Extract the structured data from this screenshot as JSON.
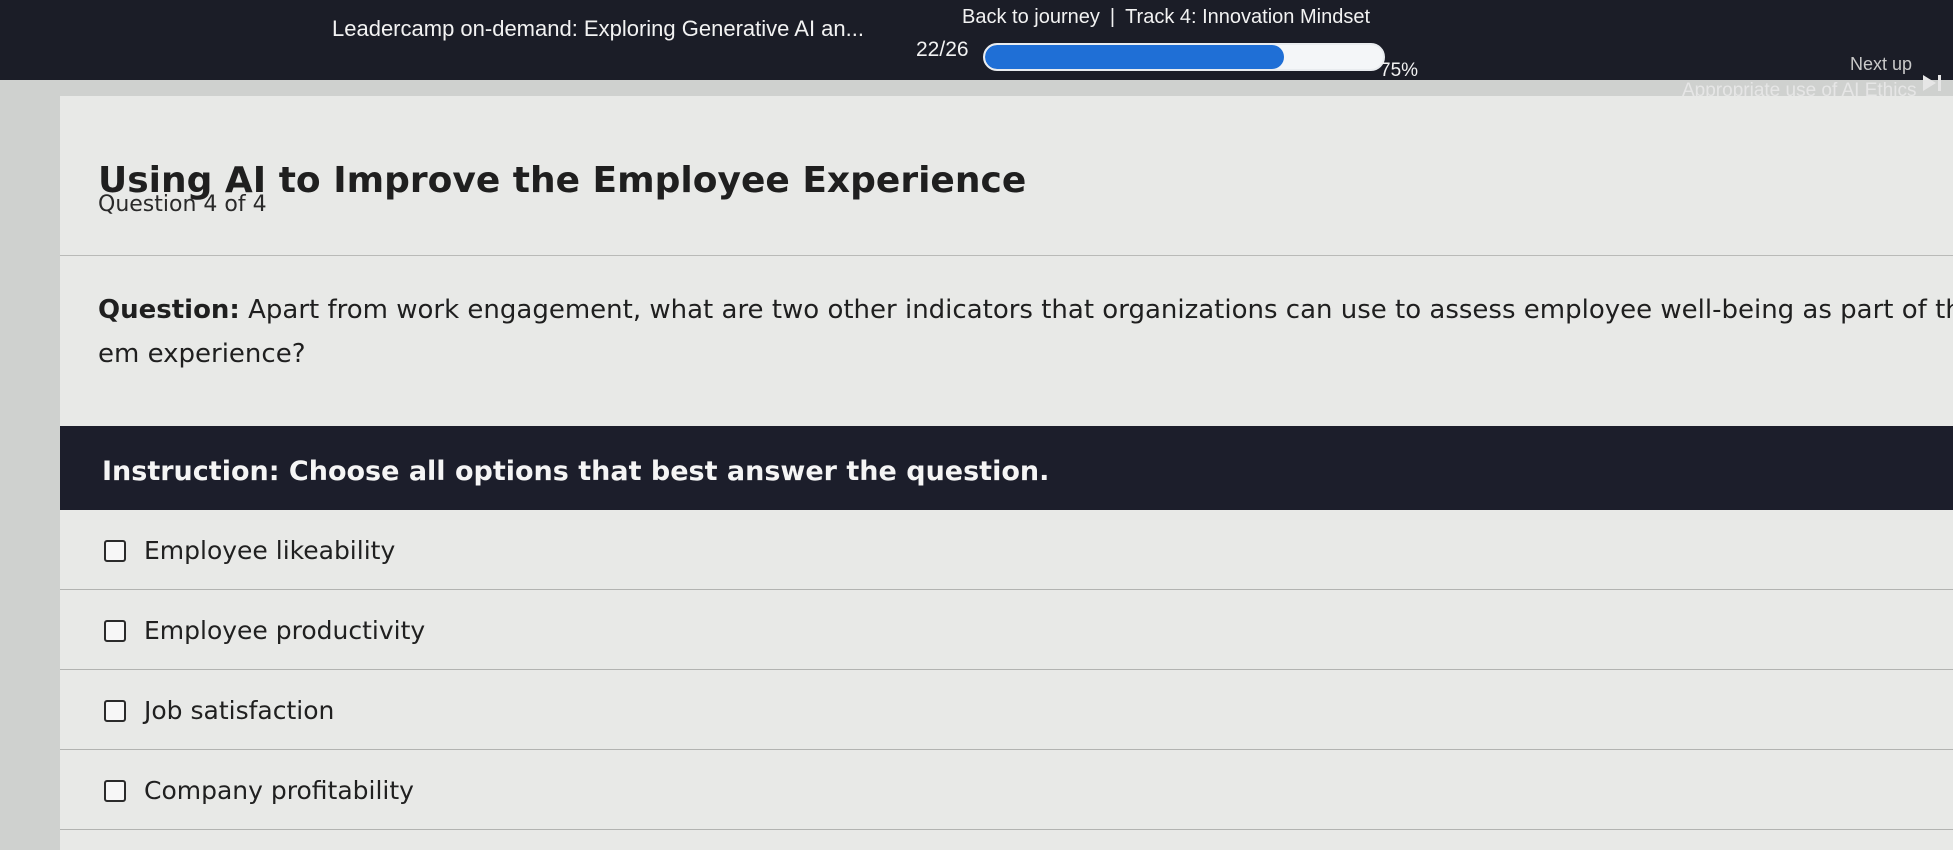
{
  "header": {
    "course_title": "Leadercamp on-demand: Exploring Generative AI an...",
    "back_link": "Back to journey",
    "separator": "|",
    "track": "Track 4: Innovation Mindset",
    "progress_count": "22/26",
    "progress_percent_label": "75%",
    "progress_value": 0.75,
    "next_up_label": "Next up",
    "next_title": "Appropriate use of AI Ethics",
    "skip_icon": "skip-next-icon"
  },
  "lesson": {
    "title": "Using AI to Improve the Employee Experience",
    "question_count": "Question 4 of 4"
  },
  "question": {
    "label": "Question:",
    "text": "Apart from work engagement, what are two other indicators that organizations can use to assess employee well-being as part of the em experience?"
  },
  "instruction": "Instruction: Choose all options that best answer the question.",
  "options": [
    {
      "label": "Employee likeability",
      "checked": false
    },
    {
      "label": "Employee productivity",
      "checked": false
    },
    {
      "label": "Job satisfaction",
      "checked": false
    },
    {
      "label": "Company profitability",
      "checked": false
    }
  ],
  "colors": {
    "topbar": "#1b1d27",
    "progress_fill": "#1f6fd6",
    "instruction_bar": "#1c1e2b",
    "card": "#e8e9e7"
  }
}
